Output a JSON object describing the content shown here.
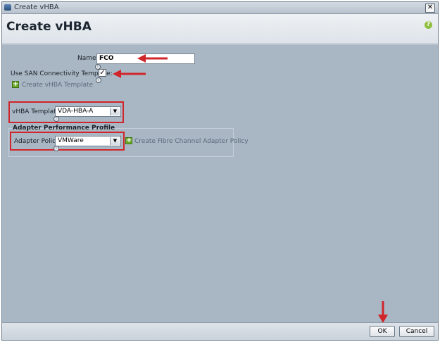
{
  "window": {
    "title": "Create vHBA",
    "close_glyph": "✕"
  },
  "header": {
    "heading": "Create vHBA",
    "help_glyph": "?"
  },
  "form": {
    "name_label": "Name:",
    "name_value": "FCO",
    "san_template_label": "Use SAN Connectivity Template:",
    "san_template_checked": true,
    "check_glyph": "✓",
    "create_template_link": "Create vHBA Template",
    "vhba_template_label": "vHBA Template:",
    "vhba_template_value": "VDA-HBA-A",
    "section_title": "Adapter Performance Profile",
    "adapter_policy_label": "Adapter Policy:",
    "adapter_policy_value": "VMWare",
    "create_policy_link": "Create Fibre Channel Adapter Policy"
  },
  "icons": {
    "info": "i",
    "plus": "+",
    "dropdown": "▼"
  },
  "footer": {
    "ok_label": "OK",
    "cancel_label": "Cancel"
  },
  "colors": {
    "highlight": "#d0252a",
    "panel": "#a9b7c5",
    "plus_green": "#6cab2c"
  }
}
